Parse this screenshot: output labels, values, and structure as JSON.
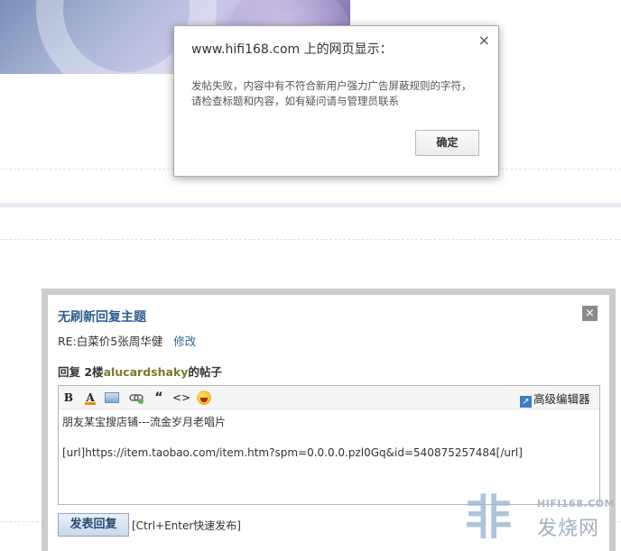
{
  "alert": {
    "title": "www.hifi168.com 上的网页显示：",
    "message": "发帖失败，内容中有不符合新用户强力广告屏蔽规则的字符，请检查标题和内容，如有疑问请与管理员联系",
    "ok_label": "确定",
    "close_glyph": "×"
  },
  "reply": {
    "title": "无刷新回复主题",
    "close_glyph": "×",
    "subject": "RE:白菜价5张周华健",
    "edit_label": "修改",
    "reply_to_prefix": "回复 2楼",
    "reply_to_user": "alucardshaky",
    "reply_to_suffix": "的帖子",
    "toolbar": {
      "bold": "B",
      "color": "A",
      "image_icon": "image-icon",
      "link_icon": "link-icon",
      "quote": "“",
      "code": "<>",
      "smiley_icon": "smiley-icon",
      "advanced_label": "高级编辑器",
      "advanced_icon": "arrow-icon"
    },
    "content": "朋友某宝搜店铺---流金岁月老唱片\n\n[url]https://item.taobao.com/item.htm?spm=0.0.0.0.pzl0Gq&id=540875257484[/url]",
    "submit_label": "发表回复",
    "hint": "[Ctrl+Enter快速发布]"
  },
  "watermark": {
    "site": "HIFI168.COM",
    "name": "发烧网"
  },
  "colors": {
    "dialog_title": "#2b5c8f",
    "username": "#7a7a2a",
    "dialog_border": "#cccccc"
  }
}
